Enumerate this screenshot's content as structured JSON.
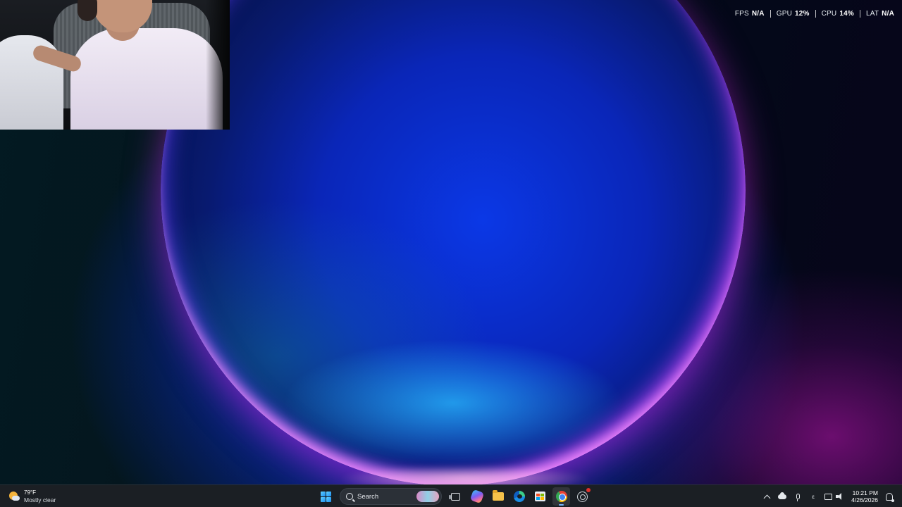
{
  "overlay": {
    "stats": [
      {
        "label": "FPS",
        "value": "N/A"
      },
      {
        "label": "GPU",
        "value": "12%"
      },
      {
        "label": "CPU",
        "value": "14%"
      },
      {
        "label": "LAT",
        "value": "N/A"
      }
    ]
  },
  "webcam": {
    "content": "webcam-feed"
  },
  "taskbar": {
    "weather": {
      "temp": "79°F",
      "condition": "Mostly clear",
      "icon": "partly-cloudy-night-icon"
    },
    "search": {
      "label": "Search"
    },
    "apps": [
      {
        "name": "Start",
        "icon": "windows-start-icon"
      },
      {
        "name": "Task View",
        "icon": "task-view-icon"
      },
      {
        "name": "Copilot",
        "icon": "copilot-icon"
      },
      {
        "name": "File Explorer",
        "icon": "folder-icon"
      },
      {
        "name": "Microsoft Edge",
        "icon": "edge-icon"
      },
      {
        "name": "Microsoft Store",
        "icon": "store-icon"
      },
      {
        "name": "Google Chrome",
        "icon": "chrome-icon",
        "active": true
      },
      {
        "name": "OBS Studio",
        "icon": "obs-icon",
        "recording": true
      }
    ],
    "tray": {
      "language": "ε",
      "time": "10:21 PM",
      "date": "4/26/2026"
    }
  },
  "colors": {
    "taskbar_bg": "#1b1f24",
    "accent": "#79b8ff",
    "recording": "#e0312c"
  }
}
